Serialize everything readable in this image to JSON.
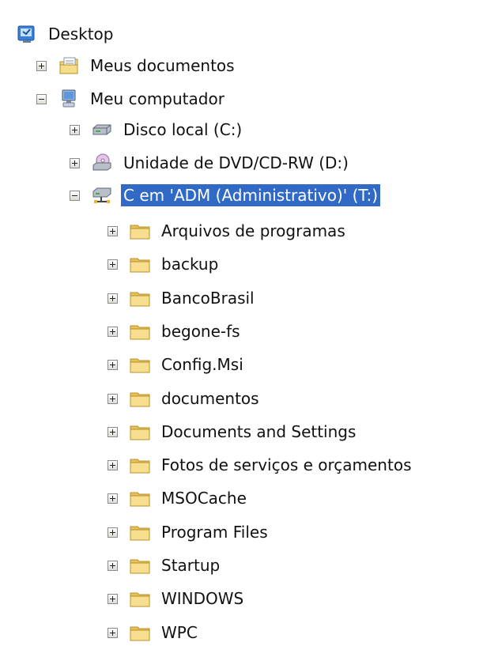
{
  "tree": {
    "root": {
      "label": "Desktop",
      "icon": "desktop-icon"
    },
    "level1": [
      {
        "label": "Meus documentos",
        "icon": "my-documents-icon",
        "expander": "+"
      },
      {
        "label": "Meu computador",
        "icon": "my-computer-icon",
        "expander": "-"
      }
    ],
    "drives": [
      {
        "label": "Disco local (C:)",
        "icon": "local-disk-icon",
        "expander": "+"
      },
      {
        "label": "Unidade de DVD/CD-RW (D:)",
        "icon": "dvd-drive-icon",
        "expander": "+"
      },
      {
        "label": "C em 'ADM (Administrativo)' (T:)",
        "icon": "network-drive-icon",
        "expander": "-",
        "selected": true
      }
    ],
    "folders": [
      {
        "label": "Arquivos de programas"
      },
      {
        "label": "backup"
      },
      {
        "label": "BancoBrasil"
      },
      {
        "label": "begone-fs"
      },
      {
        "label": "Config.Msi"
      },
      {
        "label": "documentos"
      },
      {
        "label": "Documents and Settings"
      },
      {
        "label": "Fotos de serviços e orçamentos"
      },
      {
        "label": "MSOCache"
      },
      {
        "label": "Program Files"
      },
      {
        "label": "Startup"
      },
      {
        "label": "WINDOWS"
      },
      {
        "label": "WPC"
      }
    ]
  },
  "colors": {
    "selection": "#3169c6",
    "folder": "#f3d67a"
  }
}
